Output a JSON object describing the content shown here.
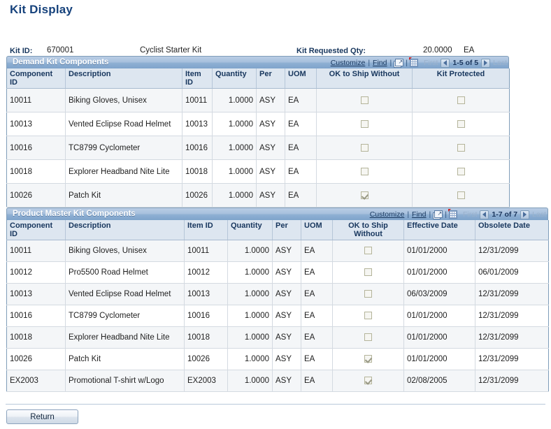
{
  "page": {
    "title": "Kit Display"
  },
  "kit_header": {
    "kit_id_label": "Kit ID:",
    "kit_id_value": "670001",
    "kit_description": "Cyclist Starter Kit",
    "requested_qty_label": "Kit Requested Qty:",
    "requested_qty_value": "20.0000",
    "requested_qty_uom": "EA"
  },
  "nav_common": {
    "customize": "Customize",
    "find": "Find",
    "separator": "|",
    "first": "First",
    "last": "Last",
    "expand_icon": "expand-icon",
    "grid_icon": "download-grid-icon",
    "prev_icon": "prev-arrow-icon",
    "next_icon": "next-arrow-icon"
  },
  "demand_grid": {
    "title": "Demand Kit Components",
    "pager_count": "1-5 of 5",
    "columns": [
      "Component ID",
      "Description",
      "Item ID",
      "Quantity",
      "Per",
      "UOM",
      "OK to Ship Without",
      "Kit Protected"
    ],
    "rows": [
      {
        "component_id": "10011",
        "description": "Biking Gloves, Unisex",
        "item_id": "10011",
        "quantity": "1.0000",
        "per": "ASY",
        "uom": "EA",
        "ok_to_ship_without": false,
        "kit_protected": false
      },
      {
        "component_id": "10013",
        "description": "Vented Eclipse Road Helmet",
        "item_id": "10013",
        "quantity": "1.0000",
        "per": "ASY",
        "uom": "EA",
        "ok_to_ship_without": false,
        "kit_protected": false
      },
      {
        "component_id": "10016",
        "description": "TC8799 Cyclometer",
        "item_id": "10016",
        "quantity": "1.0000",
        "per": "ASY",
        "uom": "EA",
        "ok_to_ship_without": false,
        "kit_protected": false
      },
      {
        "component_id": "10018",
        "description": "Explorer Headband Nite Lite",
        "item_id": "10018",
        "quantity": "1.0000",
        "per": "ASY",
        "uom": "EA",
        "ok_to_ship_without": false,
        "kit_protected": false
      },
      {
        "component_id": "10026",
        "description": "Patch Kit",
        "item_id": "10026",
        "quantity": "1.0000",
        "per": "ASY",
        "uom": "EA",
        "ok_to_ship_without": true,
        "kit_protected": false
      }
    ]
  },
  "product_master_grid": {
    "title": "Product Master Kit Components",
    "pager_count": "1-7 of 7",
    "columns": [
      "Component ID",
      "Description",
      "Item ID",
      "Quantity",
      "Per",
      "UOM",
      "OK to Ship Without",
      "Effective Date",
      "Obsolete Date"
    ],
    "rows": [
      {
        "component_id": "10011",
        "description": "Biking Gloves, Unisex",
        "item_id": "10011",
        "quantity": "1.0000",
        "per": "ASY",
        "uom": "EA",
        "ok_to_ship_without": false,
        "effective_date": "01/01/2000",
        "obsolete_date": "12/31/2099"
      },
      {
        "component_id": "10012",
        "description": "Pro5500 Road Helmet",
        "item_id": "10012",
        "quantity": "1.0000",
        "per": "ASY",
        "uom": "EA",
        "ok_to_ship_without": false,
        "effective_date": "01/01/2000",
        "obsolete_date": "06/01/2009"
      },
      {
        "component_id": "10013",
        "description": "Vented Eclipse Road Helmet",
        "item_id": "10013",
        "quantity": "1.0000",
        "per": "ASY",
        "uom": "EA",
        "ok_to_ship_without": false,
        "effective_date": "06/03/2009",
        "obsolete_date": "12/31/2099"
      },
      {
        "component_id": "10016",
        "description": "TC8799 Cyclometer",
        "item_id": "10016",
        "quantity": "1.0000",
        "per": "ASY",
        "uom": "EA",
        "ok_to_ship_without": false,
        "effective_date": "01/01/2000",
        "obsolete_date": "12/31/2099"
      },
      {
        "component_id": "10018",
        "description": "Explorer Headband Nite Lite",
        "item_id": "10018",
        "quantity": "1.0000",
        "per": "ASY",
        "uom": "EA",
        "ok_to_ship_without": false,
        "effective_date": "01/01/2000",
        "obsolete_date": "12/31/2099"
      },
      {
        "component_id": "10026",
        "description": "Patch Kit",
        "item_id": "10026",
        "quantity": "1.0000",
        "per": "ASY",
        "uom": "EA",
        "ok_to_ship_without": true,
        "effective_date": "01/01/2000",
        "obsolete_date": "12/31/2099"
      },
      {
        "component_id": "EX2003",
        "description": "Promotional T-shirt w/Logo",
        "item_id": "EX2003",
        "quantity": "1.0000",
        "per": "ASY",
        "uom": "EA",
        "ok_to_ship_without": true,
        "effective_date": "02/08/2005",
        "obsolete_date": "12/31/2099"
      }
    ]
  },
  "footer": {
    "return_label": "Return"
  },
  "colors": {
    "title_blue": "#16427c",
    "header_gradient_top": "#b9cde5",
    "header_gradient_bottom": "#7ea3cb",
    "column_header_bg": "#dde6f0",
    "alt_row_bg": "#f4f6f8",
    "grid_border": "#7f9db9"
  }
}
